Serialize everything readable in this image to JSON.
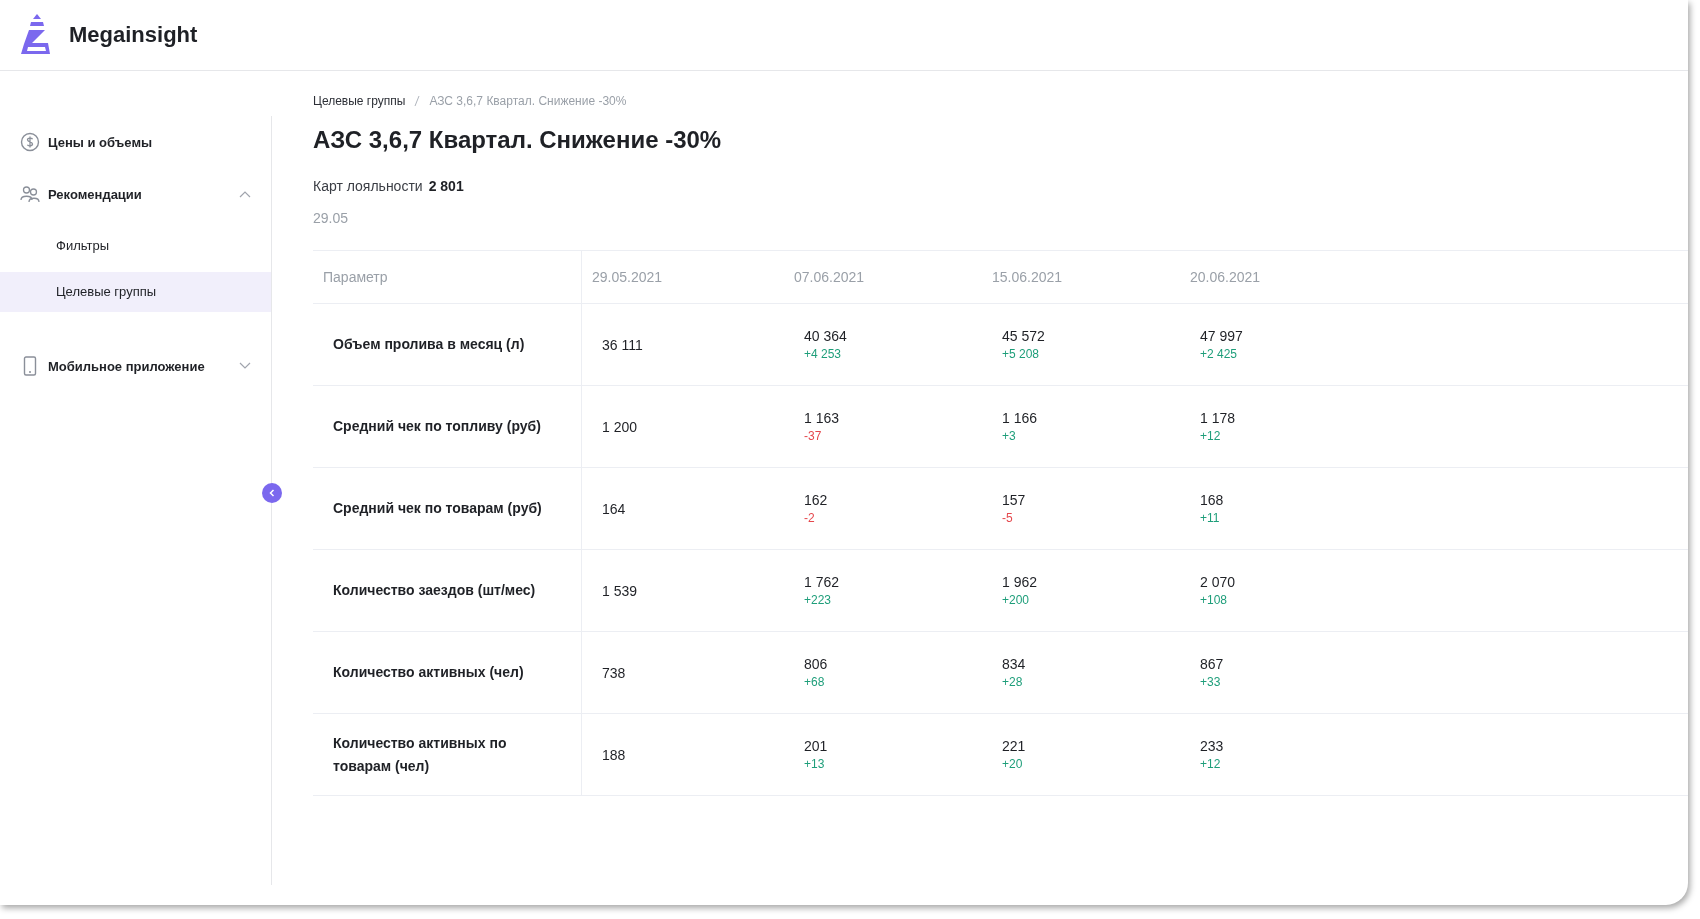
{
  "app": {
    "name": "Megainsight"
  },
  "sidebar": {
    "items": [
      {
        "kind": "link",
        "label": "Цены и объемы"
      },
      {
        "kind": "group",
        "label": "Рекомендации",
        "expanded": true,
        "children": [
          {
            "label": "Фильтры",
            "selected": false
          },
          {
            "label": "Целевые группы",
            "selected": true
          }
        ]
      },
      {
        "kind": "group",
        "label": "Мобильное приложение",
        "expanded": false
      }
    ]
  },
  "breadcrumbs": [
    "Целевые группы",
    "АЗС 3,6,7 Квартал. Снижение -30%"
  ],
  "title": "АЗС 3,6,7 Квартал. Снижение -30%",
  "loyalty": {
    "label": "Карт лояльности",
    "value": "2 801"
  },
  "date": "29.05",
  "table": {
    "columns": [
      "Параметр",
      "29.05.2021",
      "07.06.2021",
      "15.06.2021",
      "20.06.2021"
    ],
    "rows": [
      {
        "cells": [
          {
            "value": "Объем пролива в месяц (л)"
          },
          {
            "value": "36 111"
          },
          {
            "value": "40 364",
            "delta": "+4 253",
            "negative": false
          },
          {
            "value": "45 572",
            "delta": "+5 208",
            "negative": false
          },
          {
            "value": "47 997",
            "delta": "+2 425",
            "negative": false
          }
        ]
      },
      {
        "cells": [
          {
            "value": "Средний чек по топливу (руб)"
          },
          {
            "value": "1 200"
          },
          {
            "value": "1 163",
            "delta": "-37",
            "negative": true
          },
          {
            "value": "1 166",
            "delta": "+3",
            "negative": false
          },
          {
            "value": "1 178",
            "delta": "+12",
            "negative": false
          }
        ]
      },
      {
        "cells": [
          {
            "value": "Средний чек по товарам (руб)"
          },
          {
            "value": "164"
          },
          {
            "value": "162",
            "delta": "-2",
            "negative": true
          },
          {
            "value": "157",
            "delta": "-5",
            "negative": true
          },
          {
            "value": "168",
            "delta": "+11",
            "negative": false
          }
        ]
      },
      {
        "cells": [
          {
            "value": "Количество заездов (шт/мес)"
          },
          {
            "value": "1 539"
          },
          {
            "value": "1 762",
            "delta": "+223",
            "negative": false
          },
          {
            "value": "1 962",
            "delta": "+200",
            "negative": false
          },
          {
            "value": "2 070",
            "delta": "+108",
            "negative": false
          }
        ]
      },
      {
        "cells": [
          {
            "value": "Количество активных (чел)"
          },
          {
            "value": "738"
          },
          {
            "value": "806",
            "delta": "+68",
            "negative": false
          },
          {
            "value": "834",
            "delta": "+28",
            "negative": false
          },
          {
            "value": "867",
            "delta": "+33",
            "negative": false
          }
        ]
      },
      {
        "cells": [
          {
            "value": "Количество активных по товарам (чел)"
          },
          {
            "value": "188"
          },
          {
            "value": "201",
            "delta": "+13",
            "negative": false
          },
          {
            "value": "221",
            "delta": "+20",
            "negative": false
          },
          {
            "value": "233",
            "delta": "+12",
            "negative": false
          }
        ]
      }
    ]
  }
}
